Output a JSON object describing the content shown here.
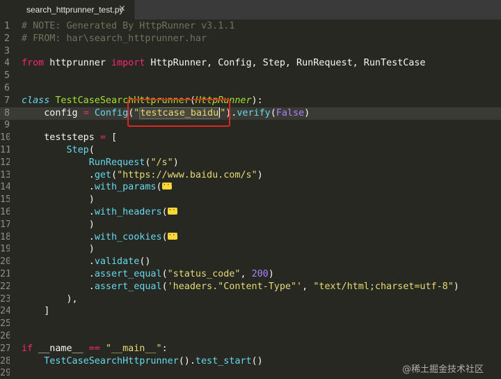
{
  "tab": {
    "filename": "search_httprunner_test.py",
    "close_glyph": "×"
  },
  "editor": {
    "lines": [
      {
        "num": "1",
        "tokens": [
          {
            "t": "comment",
            "v": "# NOTE: Generated By HttpRunner v3.1.1"
          }
        ]
      },
      {
        "num": "2",
        "tokens": [
          {
            "t": "comment",
            "v": "# FROM: har\\search_httprunner.har"
          }
        ]
      },
      {
        "num": "3",
        "tokens": []
      },
      {
        "num": "4",
        "tokens": [
          {
            "t": "kw",
            "v": "from"
          },
          {
            "t": "plain",
            "v": " httprunner "
          },
          {
            "t": "kw",
            "v": "import"
          },
          {
            "t": "plain",
            "v": " HttpRunner, Config, Step, RunRequest, RunTestCase"
          }
        ]
      },
      {
        "num": "5",
        "tokens": []
      },
      {
        "num": "6",
        "tokens": []
      },
      {
        "num": "7",
        "tokens": [
          {
            "t": "storage",
            "v": "class"
          },
          {
            "t": "plain",
            "v": " "
          },
          {
            "t": "cls",
            "v": "TestCaseSearchHttprunner"
          },
          {
            "t": "plain",
            "v": "("
          },
          {
            "t": "italic",
            "v": "HttpRunner"
          },
          {
            "t": "plain",
            "v": "):"
          }
        ]
      },
      {
        "num": "8",
        "current": true,
        "tokens": [
          {
            "t": "plain",
            "v": "    config "
          },
          {
            "t": "kw",
            "v": "="
          },
          {
            "t": "plain",
            "v": " "
          },
          {
            "t": "fn",
            "v": "Config"
          },
          {
            "t": "plain",
            "v": "("
          },
          {
            "t": "str",
            "v": "\""
          },
          {
            "t": "hl",
            "v": "testcase_baidu"
          },
          {
            "t": "cursor",
            "v": ""
          },
          {
            "t": "str",
            "v": "\""
          },
          {
            "t": "plain",
            "v": ")."
          },
          {
            "t": "fn",
            "v": "verify"
          },
          {
            "t": "plain",
            "v": "("
          },
          {
            "t": "const",
            "v": "False"
          },
          {
            "t": "plain",
            "v": ")"
          }
        ]
      },
      {
        "num": "9",
        "tokens": []
      },
      {
        "num": "10",
        "tokens": [
          {
            "t": "plain",
            "v": "    teststeps "
          },
          {
            "t": "kw",
            "v": "="
          },
          {
            "t": "plain",
            "v": " ["
          }
        ]
      },
      {
        "num": "11",
        "tokens": [
          {
            "t": "plain",
            "v": "        "
          },
          {
            "t": "fn",
            "v": "Step"
          },
          {
            "t": "plain",
            "v": "("
          }
        ]
      },
      {
        "num": "12",
        "tokens": [
          {
            "t": "plain",
            "v": "            "
          },
          {
            "t": "fn",
            "v": "RunRequest"
          },
          {
            "t": "plain",
            "v": "("
          },
          {
            "t": "str",
            "v": "\"/s\""
          },
          {
            "t": "plain",
            "v": ")"
          }
        ]
      },
      {
        "num": "13",
        "tokens": [
          {
            "t": "plain",
            "v": "            ."
          },
          {
            "t": "fn",
            "v": "get"
          },
          {
            "t": "plain",
            "v": "("
          },
          {
            "t": "str",
            "v": "\"https://www.baidu.com/s\""
          },
          {
            "t": "plain",
            "v": ")"
          }
        ]
      },
      {
        "num": "14",
        "tokens": [
          {
            "t": "plain",
            "v": "            ."
          },
          {
            "t": "fn",
            "v": "with_params"
          },
          {
            "t": "plain",
            "v": "("
          },
          {
            "t": "fold",
            "v": ""
          }
        ]
      },
      {
        "num": "15",
        "tokens": [
          {
            "t": "plain",
            "v": "            )"
          }
        ]
      },
      {
        "num": "16",
        "tokens": [
          {
            "t": "plain",
            "v": "            ."
          },
          {
            "t": "fn",
            "v": "with_headers"
          },
          {
            "t": "plain",
            "v": "("
          },
          {
            "t": "fold",
            "v": ""
          }
        ]
      },
      {
        "num": "17",
        "tokens": [
          {
            "t": "plain",
            "v": "            )"
          }
        ]
      },
      {
        "num": "18",
        "tokens": [
          {
            "t": "plain",
            "v": "            ."
          },
          {
            "t": "fn",
            "v": "with_cookies"
          },
          {
            "t": "plain",
            "v": "("
          },
          {
            "t": "fold",
            "v": ""
          }
        ]
      },
      {
        "num": "19",
        "tokens": [
          {
            "t": "plain",
            "v": "            )"
          }
        ]
      },
      {
        "num": "20",
        "tokens": [
          {
            "t": "plain",
            "v": "            ."
          },
          {
            "t": "fn",
            "v": "validate"
          },
          {
            "t": "plain",
            "v": "()"
          }
        ]
      },
      {
        "num": "21",
        "tokens": [
          {
            "t": "plain",
            "v": "            ."
          },
          {
            "t": "fn",
            "v": "assert_equal"
          },
          {
            "t": "plain",
            "v": "("
          },
          {
            "t": "str",
            "v": "\"status_code\""
          },
          {
            "t": "plain",
            "v": ", "
          },
          {
            "t": "num",
            "v": "200"
          },
          {
            "t": "plain",
            "v": ")"
          }
        ]
      },
      {
        "num": "22",
        "tokens": [
          {
            "t": "plain",
            "v": "            ."
          },
          {
            "t": "fn",
            "v": "assert_equal"
          },
          {
            "t": "plain",
            "v": "("
          },
          {
            "t": "str",
            "v": "'headers.\"Content-Type\"'"
          },
          {
            "t": "plain",
            "v": ", "
          },
          {
            "t": "str",
            "v": "\"text/html;charset=utf-8\""
          },
          {
            "t": "plain",
            "v": ")"
          }
        ]
      },
      {
        "num": "23",
        "tokens": [
          {
            "t": "plain",
            "v": "        ),"
          }
        ]
      },
      {
        "num": "24",
        "tokens": [
          {
            "t": "plain",
            "v": "    ]"
          }
        ]
      },
      {
        "num": "25",
        "tokens": []
      },
      {
        "num": "26",
        "tokens": []
      },
      {
        "num": "27",
        "tokens": [
          {
            "t": "kw",
            "v": "if"
          },
          {
            "t": "plain",
            "v": " __name__ "
          },
          {
            "t": "kw",
            "v": "=="
          },
          {
            "t": "plain",
            "v": " "
          },
          {
            "t": "str",
            "v": "\"__main__\""
          },
          {
            "t": "plain",
            "v": ":"
          }
        ]
      },
      {
        "num": "28",
        "tokens": [
          {
            "t": "plain",
            "v": "    "
          },
          {
            "t": "fn",
            "v": "TestCaseSearchHttprunner"
          },
          {
            "t": "plain",
            "v": "()."
          },
          {
            "t": "fn",
            "v": "test_start"
          },
          {
            "t": "plain",
            "v": "()"
          }
        ]
      },
      {
        "num": "29",
        "tokens": []
      }
    ]
  },
  "watermark": "@稀土掘金技术社区",
  "colors": {
    "background": "#272822",
    "annotation": "#e3241f"
  }
}
